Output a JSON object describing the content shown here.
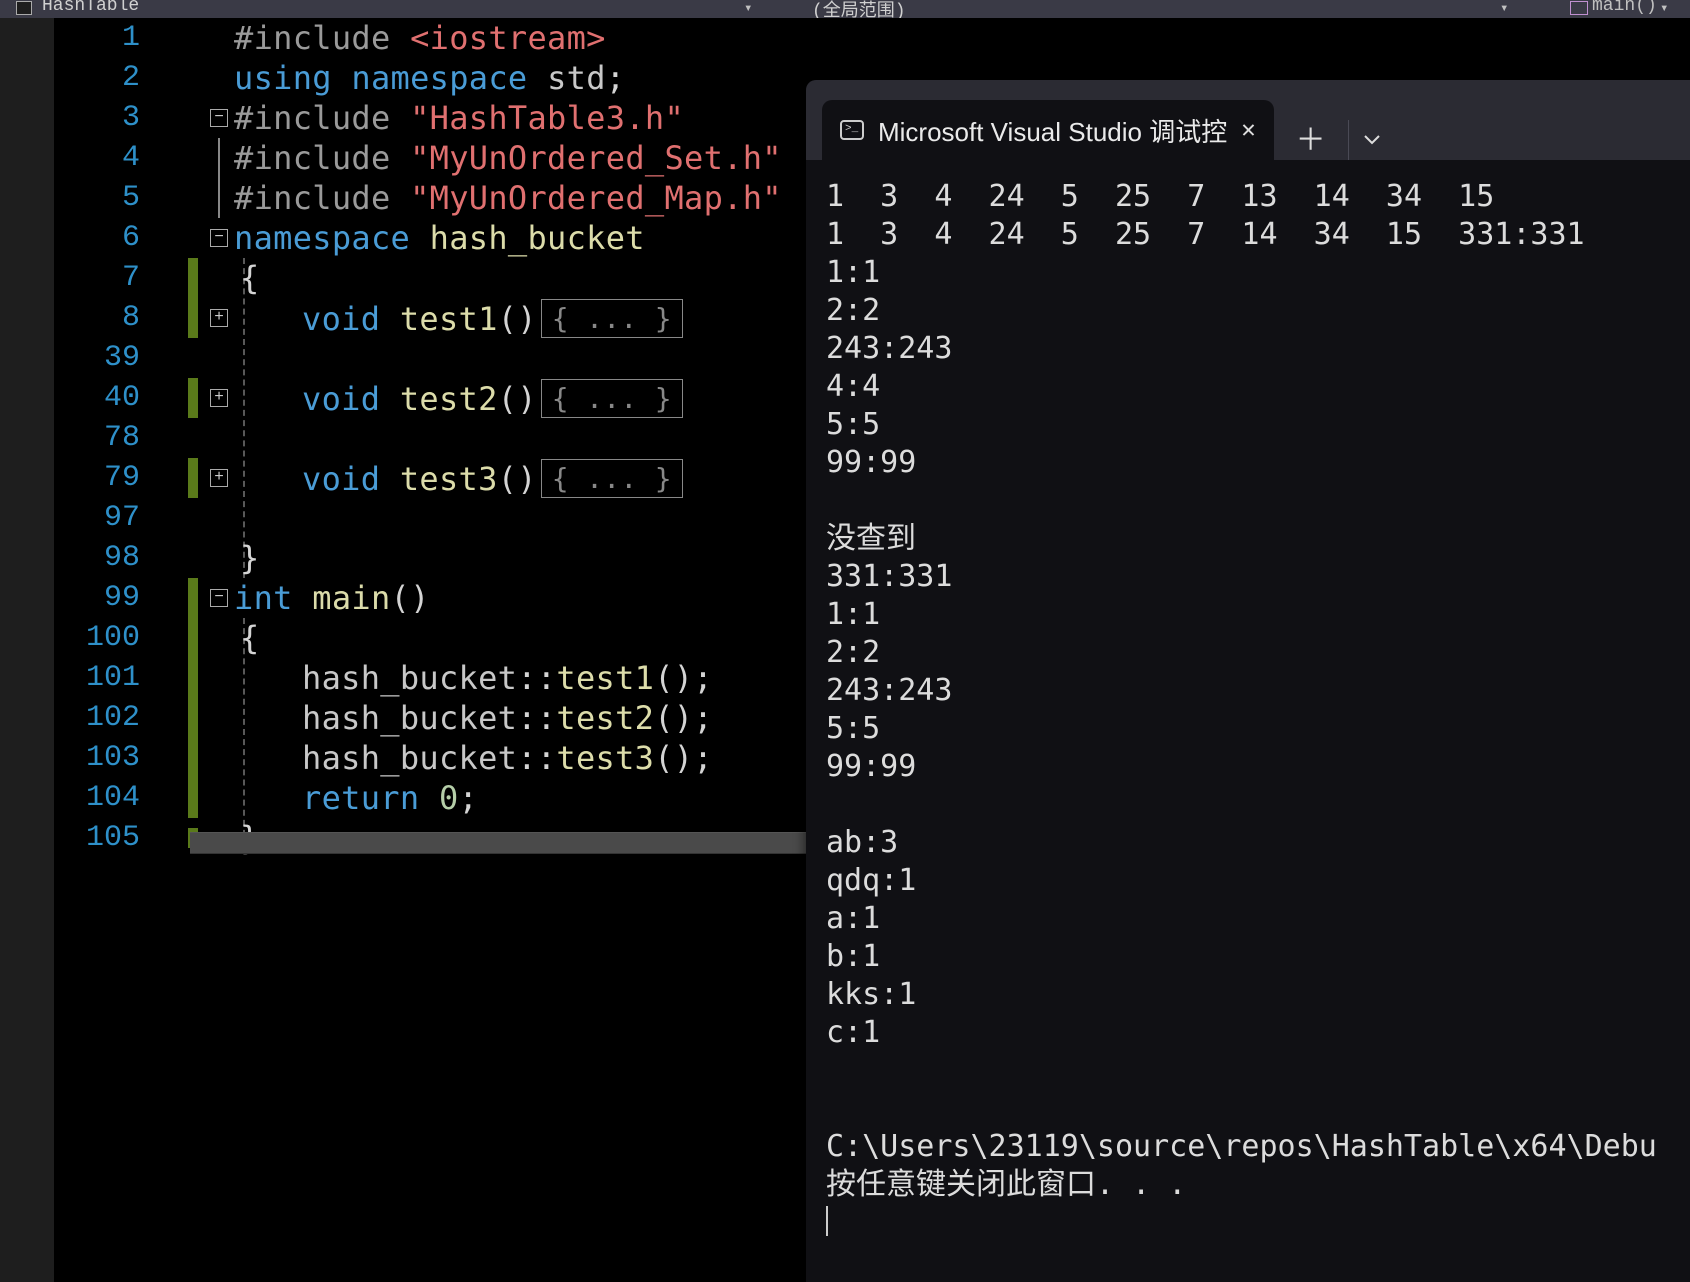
{
  "topbar": {
    "left_label": "HashTable",
    "mid_label": "(全局范围)",
    "right_fn": "main()"
  },
  "fold": {
    "minus": "−",
    "plus": "+"
  },
  "collapsed": "{ ... }",
  "lines": [
    {
      "n": 1,
      "t": 0,
      "parts": [
        [
          "pre",
          "#include "
        ],
        [
          "str",
          "<iostream>"
        ]
      ]
    },
    {
      "n": 2,
      "t": 40,
      "parts": [
        [
          "kw",
          "using "
        ],
        [
          "kw",
          "namespace "
        ],
        [
          "ns",
          "std"
        ],
        [
          "pl",
          ";"
        ]
      ]
    },
    {
      "n": 3,
      "t": 80,
      "fold": "minus",
      "parts": [
        [
          "pre",
          "#include "
        ],
        [
          "str",
          "\"HashTable3.h\""
        ]
      ]
    },
    {
      "n": 4,
      "t": 120,
      "bar": true,
      "parts": [
        [
          "pre",
          "#include "
        ],
        [
          "str",
          "\"MyUnOrdered_Set.h\""
        ]
      ]
    },
    {
      "n": 5,
      "t": 160,
      "bar": true,
      "parts": [
        [
          "pre",
          "#include "
        ],
        [
          "str",
          "\"MyUnOrdered_Map.h\""
        ]
      ]
    },
    {
      "n": 6,
      "t": 200,
      "fold": "minus",
      "parts": [
        [
          "kw",
          "namespace "
        ],
        [
          "fn",
          "hash_bucket"
        ]
      ]
    },
    {
      "n": 7,
      "t": 240,
      "git": true,
      "parts": [
        [
          "pl",
          "{"
        ],
        [
          "",
          "  "
        ]
      ],
      "indent": 1
    },
    {
      "n": 8,
      "t": 280,
      "git": true,
      "fold": "plus",
      "guide": 1,
      "indent": 2,
      "parts": [
        [
          "kw",
          "void "
        ],
        [
          "fn",
          "test1"
        ],
        [
          "pl",
          "()"
        ]
      ],
      "collapsed": true
    },
    {
      "n": 39,
      "t": 320,
      "guide": 1,
      "parts": []
    },
    {
      "n": 40,
      "t": 360,
      "git": true,
      "fold": "plus",
      "guide": 1,
      "indent": 2,
      "parts": [
        [
          "kw",
          "void "
        ],
        [
          "fn",
          "test2"
        ],
        [
          "pl",
          "()"
        ]
      ],
      "collapsed": true
    },
    {
      "n": 78,
      "t": 400,
      "guide": 1,
      "parts": []
    },
    {
      "n": 79,
      "t": 440,
      "git": true,
      "fold": "plus",
      "guide": 1,
      "indent": 2,
      "parts": [
        [
          "kw",
          "void "
        ],
        [
          "fn",
          "test3"
        ],
        [
          "pl",
          "()"
        ]
      ],
      "collapsed": true
    },
    {
      "n": 97,
      "t": 480,
      "guide": 1,
      "parts": []
    },
    {
      "n": 98,
      "t": 520,
      "indent": 1,
      "parts": [
        [
          "pl",
          "}"
        ]
      ]
    },
    {
      "n": 99,
      "t": 560,
      "git": true,
      "fold": "minus",
      "parts": [
        [
          "int",
          "int "
        ],
        [
          "fn",
          "main"
        ],
        [
          "pl",
          "()"
        ]
      ]
    },
    {
      "n": 100,
      "t": 600,
      "git": true,
      "guide": 1,
      "indent": 1,
      "parts": [
        [
          "pl",
          "{"
        ]
      ]
    },
    {
      "n": 101,
      "t": 640,
      "git": true,
      "guide": 1,
      "indent": 2,
      "parts": [
        [
          "ns",
          "hash_bucket"
        ],
        [
          "pl",
          "::"
        ],
        [
          "fn",
          "test1"
        ],
        [
          "pl",
          "();"
        ]
      ]
    },
    {
      "n": 102,
      "t": 680,
      "git": true,
      "guide": 1,
      "indent": 2,
      "parts": [
        [
          "ns",
          "hash_bucket"
        ],
        [
          "pl",
          "::"
        ],
        [
          "fn",
          "test2"
        ],
        [
          "pl",
          "();"
        ]
      ]
    },
    {
      "n": 103,
      "t": 720,
      "git": true,
      "guide": 1,
      "indent": 2,
      "parts": [
        [
          "ns",
          "hash_bucket"
        ],
        [
          "pl",
          "::"
        ],
        [
          "fn",
          "test3"
        ],
        [
          "pl",
          "();"
        ]
      ]
    },
    {
      "n": 104,
      "t": 760,
      "git": true,
      "guide": 1,
      "indent": 2,
      "parts": [
        [
          "kw",
          "return "
        ],
        [
          "num",
          "0"
        ],
        [
          "pl",
          ";"
        ]
      ]
    },
    {
      "n": 105,
      "t": 800,
      "git": "half",
      "indent": 1,
      "parts": [
        [
          "pl",
          "}"
        ]
      ]
    }
  ],
  "terminal": {
    "tab_title": "Microsoft Visual Studio 调试控",
    "output": "1  3  4  24  5  25  7  13  14  34  15\n1  3  4  24  5  25  7  14  34  15  331:331\n1:1\n2:2\n243:243\n4:4\n5:5\n99:99\n\n没查到\n331:331\n1:1\n2:2\n243:243\n5:5\n99:99\n\nab:3\nqdq:1\na:1\nb:1\nkks:1\nc:1\n\n\nC:\\Users\\23119\\source\\repos\\HashTable\\x64\\Debu\n按任意键关闭此窗口. . ."
  }
}
